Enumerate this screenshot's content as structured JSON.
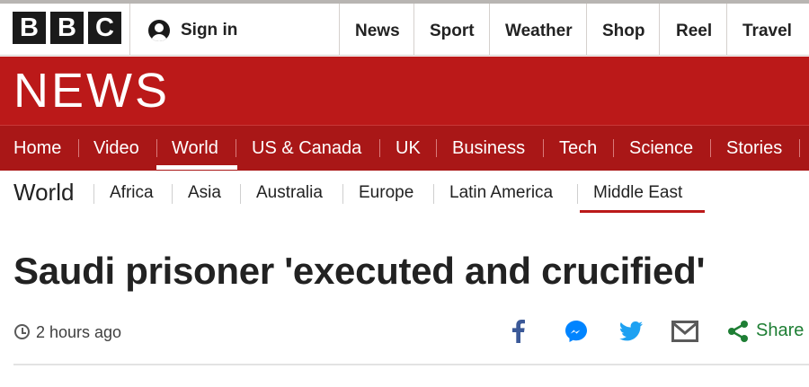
{
  "brand": {
    "letters": [
      "B",
      "B",
      "C"
    ]
  },
  "topbar": {
    "signin_label": "Sign in",
    "nav": [
      "News",
      "Sport",
      "Weather",
      "Shop",
      "Reel",
      "Travel"
    ]
  },
  "news": {
    "wordmark": "NEWS",
    "nav": [
      "Home",
      "Video",
      "World",
      "US & Canada",
      "UK",
      "Business",
      "Tech",
      "Science",
      "Stories"
    ],
    "active": "World"
  },
  "subnav": {
    "title": "World",
    "items": [
      "Africa",
      "Asia",
      "Australia",
      "Europe",
      "Latin America",
      "Middle East"
    ],
    "active": "Middle East"
  },
  "article": {
    "headline": "Saudi prisoner 'executed and crucified'",
    "timestamp": "2 hours ago"
  },
  "share": {
    "label": "Share",
    "icons": [
      "facebook-icon",
      "messenger-icon",
      "twitter-icon",
      "email-icon",
      "share-icon"
    ]
  },
  "colors": {
    "brand_red": "#bb1919",
    "nav_red": "#a91717",
    "share_green": "#1e7e34",
    "facebook_blue": "#3b5998",
    "messenger_blue": "#0084ff",
    "twitter_blue": "#1da1f2"
  }
}
